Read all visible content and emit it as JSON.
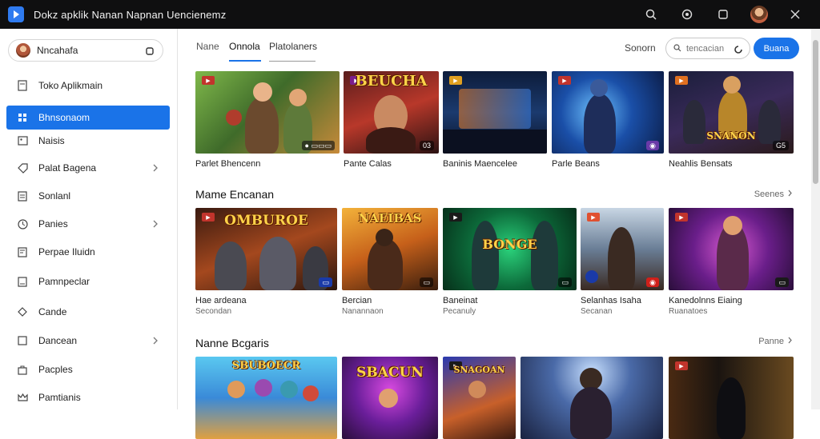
{
  "window": {
    "title": "Dokz apklik Nanan Napnan Uencienemz",
    "accent": "#1a73e8"
  },
  "titlebar": {
    "icons": [
      "search-icon",
      "settings-icon",
      "window-icon",
      "avatar",
      "close-icon"
    ]
  },
  "sidebar": {
    "account_name": "Nncahafa",
    "items": [
      {
        "label": "Toko Aplikmain",
        "icon": "doc-icon"
      },
      {
        "label": "Bhnsonaom",
        "icon": "grid-icon",
        "active": true
      },
      {
        "label": "Naisis",
        "icon": "image-icon"
      },
      {
        "label": "Palat Bagena",
        "icon": "tag-icon",
        "chevron": true
      },
      {
        "label": "Sonlanl",
        "icon": "list-icon"
      },
      {
        "label": "Panies",
        "icon": "clock-icon",
        "chevron": true
      },
      {
        "label": "Perpae Iluidn",
        "icon": "doc2-icon"
      },
      {
        "label": "Pamnpeclar",
        "icon": "doc3-icon"
      },
      {
        "label": "Cande",
        "icon": "diamond-icon"
      },
      {
        "label": "Dancean",
        "icon": "box-icon",
        "chevron": true
      },
      {
        "label": "Pacples",
        "icon": "bag-icon"
      },
      {
        "label": "Pamtianis",
        "icon": "crown-icon"
      }
    ]
  },
  "tabs": [
    "Nane",
    "Onnola",
    "Platolaners"
  ],
  "toolbar": {
    "sort_label": "Sonorn",
    "search_placeholder": "tencacian",
    "button_label": "Buana"
  },
  "row1": {
    "cards": [
      {
        "title": "Parlet Bhencenn",
        "rating": ""
      },
      {
        "title": "Pante Calas",
        "logo": "BEUCHA",
        "rating": "03"
      },
      {
        "title": "Baninis Maencelee",
        "rating": ""
      },
      {
        "title": "Parle Beans",
        "rating": ""
      },
      {
        "title": "Neahlis Bensats",
        "logo": "SNANON",
        "rating": "G5"
      }
    ]
  },
  "row2": {
    "title": "Mame Encanan",
    "see_all": "Seenes",
    "cards": [
      {
        "title": "Hae ardeana",
        "sub": "Secondan",
        "logo": "OMBUROE"
      },
      {
        "title": "Bercian",
        "sub": "Nanannaon",
        "logo": "NAEIBAS"
      },
      {
        "title": "Baneinat",
        "sub": "Pecanuly",
        "logo": "BONGE"
      },
      {
        "title": "Selanhas Isaha",
        "sub": "Secanan",
        "logo": ""
      },
      {
        "title": "Kanedolnns Eiaing",
        "sub": "Ruanatoes",
        "logo": ""
      }
    ]
  },
  "row3": {
    "title": "Nanne Bcgaris",
    "see_all": "Panne",
    "cards": [
      {
        "logo": "SBUBOECR"
      },
      {
        "logo": "SBACUN"
      },
      {
        "logo": "SNAGOAN"
      },
      {
        "logo": ""
      },
      {
        "logo": ""
      }
    ]
  }
}
